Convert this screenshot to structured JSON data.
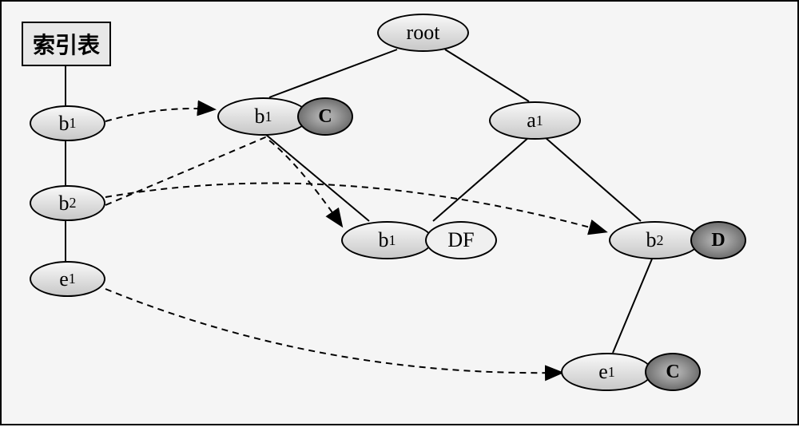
{
  "chart_data": {
    "type": "tree-diagram",
    "title": "索引表",
    "root_label": "root",
    "index_items": [
      {
        "id": "idx-b1",
        "label": "b",
        "sub": "1"
      },
      {
        "id": "idx-b2",
        "label": "b",
        "sub": "2"
      },
      {
        "id": "idx-e1",
        "label": "e",
        "sub": "1"
      }
    ],
    "tree_nodes": [
      {
        "id": "root",
        "label": "root",
        "sub": "",
        "parent": null,
        "annot": ""
      },
      {
        "id": "n-b1",
        "label": "b",
        "sub": "1",
        "parent": "root",
        "annot": "C"
      },
      {
        "id": "n-a1",
        "label": "a",
        "sub": "1",
        "parent": "root",
        "annot": ""
      },
      {
        "id": "n-b1b",
        "label": "b",
        "sub": "1",
        "parent": "n-b1",
        "annot": "DF"
      },
      {
        "id": "n-b2",
        "label": "b",
        "sub": "2",
        "parent": "n-a1",
        "annot": "D"
      },
      {
        "id": "n-e1",
        "label": "e",
        "sub": "1",
        "parent": "n-b2",
        "annot": "C"
      }
    ],
    "dashed_links": [
      {
        "from": "idx-b1",
        "to": "n-b1"
      },
      {
        "from": "idx-b2",
        "to": "n-b1b"
      },
      {
        "from": "idx-b2",
        "to": "n-b2"
      },
      {
        "from": "idx-e1",
        "to": "n-e1"
      }
    ]
  },
  "index_box_label": "索引表",
  "root_label": "root",
  "idx_b1_label": "b",
  "idx_b1_sub": "1",
  "idx_b2_label": "b",
  "idx_b2_sub": "2",
  "idx_e1_label": "e",
  "idx_e1_sub": "1",
  "n_b1_label": "b",
  "n_b1_sub": "1",
  "n_b1_annot": "C",
  "n_a1_label": "a",
  "n_a1_sub": "1",
  "n_b1b_label": "b",
  "n_b1b_sub": "1",
  "n_b1b_annot": "DF",
  "n_b2_label": "b",
  "n_b2_sub": "2",
  "n_b2_annot": "D",
  "n_e1_label": "e",
  "n_e1_sub": "1",
  "n_e1_annot": "C"
}
